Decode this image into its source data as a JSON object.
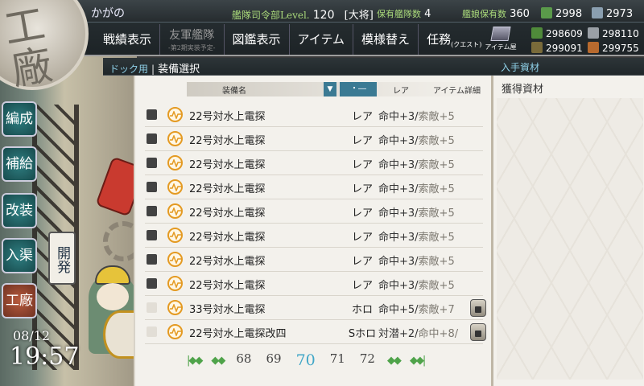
{
  "admiral": {
    "name": "かがの",
    "hq_label": "艦隊司令部Level.",
    "hq_level": "120",
    "rank": "[大将]"
  },
  "stats": {
    "ships_label": "保有艦隊数",
    "ships_value": "4",
    "shipgirls_label": "艦娘保有数",
    "shipgirls_value": "360",
    "bucket_value": "2998",
    "devmat_value": "2973"
  },
  "menu": {
    "record": "戦績表示",
    "friend": "友軍艦隊",
    "friend_sub": "-第2期実装予定-",
    "encyclopedia": "図鑑表示",
    "items": "アイテム",
    "remodel_room": "模様替え",
    "quests": "任務",
    "quests_sub": "(クエスト)",
    "item_shop": "アイテム屋"
  },
  "resources": {
    "fuel": "298609",
    "steel": "298110",
    "ammo": "299091",
    "bauxite": "299755"
  },
  "colors": {
    "fuel": "#4f8a3a",
    "ammo": "#7a6b3a",
    "steel": "#9aa0a6",
    "bauxite": "#b86a2e",
    "bucket": "#5a9a4a",
    "devmat": "#8a9fb0",
    "accent": "#3fa6c7"
  },
  "sidebar": {
    "organize": "編成",
    "supply": "補給",
    "remodel": "改装",
    "repair": "入渠",
    "arsenal": "工廠",
    "develop": "開発"
  },
  "clock": {
    "date": "08/12",
    "time": "19:57"
  },
  "breadcrumb": {
    "parent": "ドック用",
    "current": "装備選択",
    "right": "入手資材"
  },
  "list": {
    "col_name": "装備名",
    "col_rare": "レア",
    "col_detail": "アイテム詳細",
    "sort_icon": "▼",
    "view_label": "・―",
    "rows": [
      {
        "name": "22号対水上電探",
        "rare": "レア",
        "d1": "命中+3/",
        "d2": "索敵+5",
        "checked": true,
        "locked": false
      },
      {
        "name": "22号対水上電探",
        "rare": "レア",
        "d1": "命中+3/",
        "d2": "索敵+5",
        "checked": true,
        "locked": false
      },
      {
        "name": "22号対水上電探",
        "rare": "レア",
        "d1": "命中+3/",
        "d2": "索敵+5",
        "checked": true,
        "locked": false
      },
      {
        "name": "22号対水上電探",
        "rare": "レア",
        "d1": "命中+3/",
        "d2": "索敵+5",
        "checked": true,
        "locked": false
      },
      {
        "name": "22号対水上電探",
        "rare": "レア",
        "d1": "命中+3/",
        "d2": "索敵+5",
        "checked": true,
        "locked": false
      },
      {
        "name": "22号対水上電探",
        "rare": "レア",
        "d1": "命中+3/",
        "d2": "索敵+5",
        "checked": true,
        "locked": false
      },
      {
        "name": "22号対水上電探",
        "rare": "レア",
        "d1": "命中+3/",
        "d2": "索敵+5",
        "checked": true,
        "locked": false
      },
      {
        "name": "22号対水上電探",
        "rare": "レア",
        "d1": "命中+3/",
        "d2": "索敵+5",
        "checked": true,
        "locked": false
      },
      {
        "name": "33号対水上電探",
        "rare": "ホロ",
        "d1": "命中+5/",
        "d2": "索敵+7",
        "checked": false,
        "locked": true
      },
      {
        "name": "22号対水上電探改四",
        "rare": "Sホロ",
        "d1": "対潜+2/",
        "d2": "命中+8/",
        "checked": false,
        "locked": true
      }
    ]
  },
  "pager": {
    "first": "|◆◆",
    "prev": "◆◆",
    "next": "◆◆",
    "last": "◆◆|",
    "pages": [
      "68",
      "69",
      "70",
      "71",
      "72"
    ],
    "current": "70"
  },
  "right_panel": {
    "title": "獲得資材"
  }
}
